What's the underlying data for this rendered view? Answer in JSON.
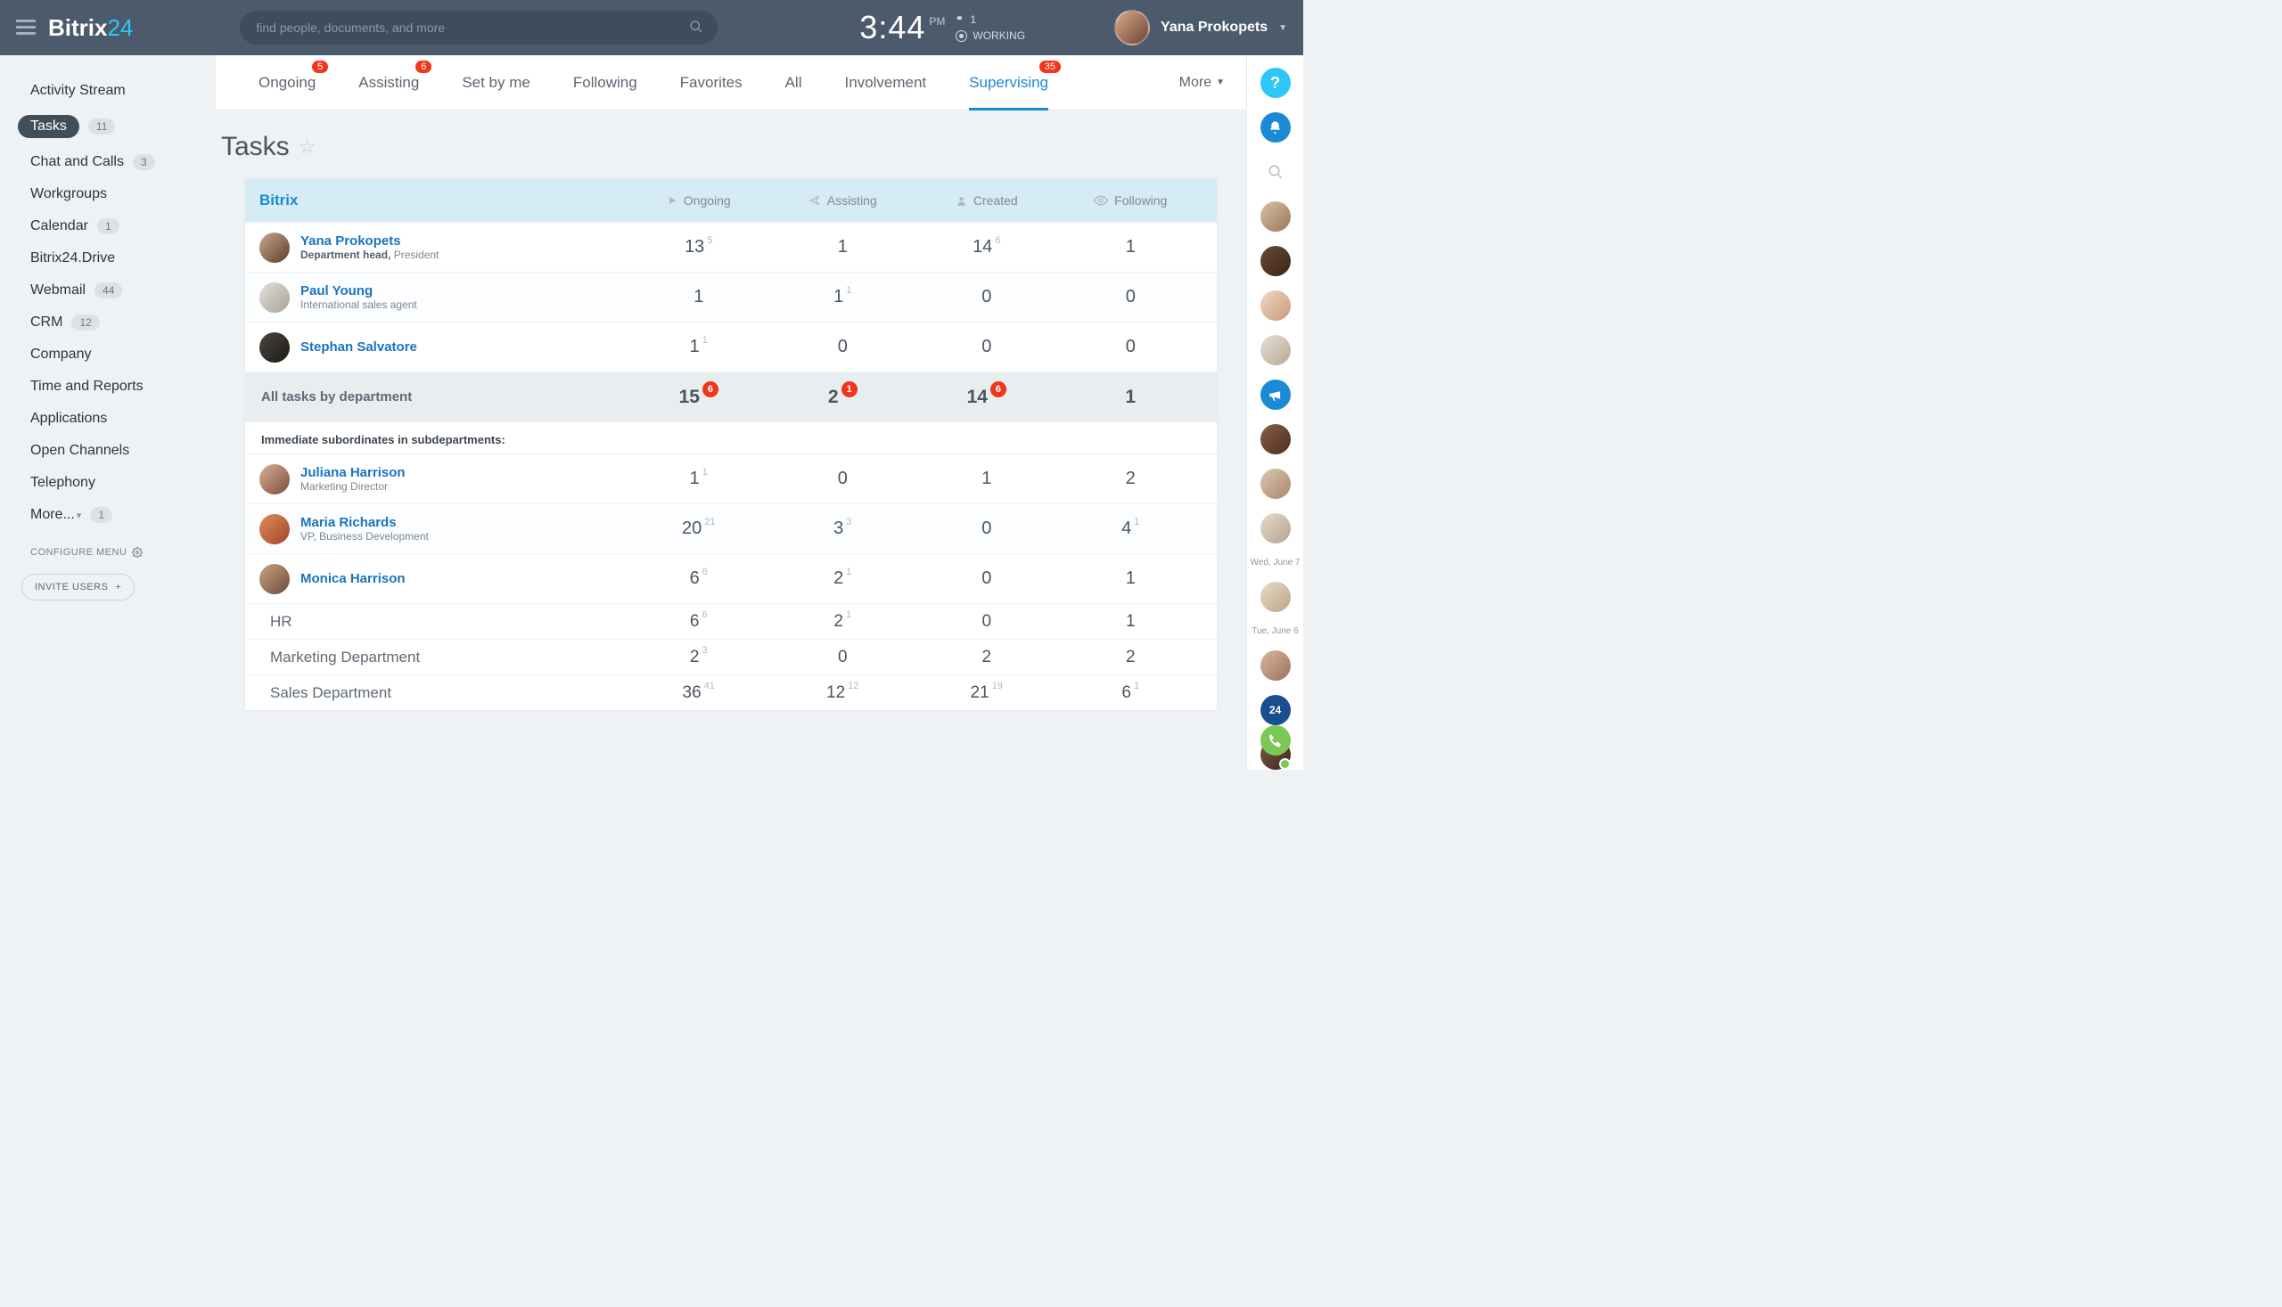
{
  "brand": {
    "a": "Bitrix",
    "b": "24"
  },
  "search": {
    "placeholder": "find people, documents, and more"
  },
  "clock": {
    "time": "3:44",
    "ampm": "PM",
    "flag": "1",
    "working": "WORKING"
  },
  "user": {
    "name": "Yana Prokopets"
  },
  "sidebar": {
    "items": [
      {
        "label": "Activity Stream"
      },
      {
        "label": "Tasks",
        "badge": "11",
        "active": true
      },
      {
        "label": "Chat and Calls",
        "badge": "3"
      },
      {
        "label": "Workgroups"
      },
      {
        "label": "Calendar",
        "badge": "1"
      },
      {
        "label": "Bitrix24.Drive"
      },
      {
        "label": "Webmail",
        "badge": "44"
      },
      {
        "label": "CRM",
        "badge": "12"
      },
      {
        "label": "Company"
      },
      {
        "label": "Time and Reports"
      },
      {
        "label": "Applications"
      },
      {
        "label": "Open Channels"
      },
      {
        "label": "Telephony"
      },
      {
        "label": "More... ",
        "badge": "1",
        "caret": true
      }
    ],
    "configure": "CONFIGURE MENU",
    "invite": "INVITE USERS"
  },
  "tabs": {
    "items": [
      {
        "label": "Ongoing",
        "badge": "5"
      },
      {
        "label": "Assisting",
        "badge": "6"
      },
      {
        "label": "Set by me"
      },
      {
        "label": "Following"
      },
      {
        "label": "Favorites"
      },
      {
        "label": "All"
      },
      {
        "label": "Involvement"
      },
      {
        "label": "Supervising",
        "badge": "35",
        "active": true
      }
    ],
    "more": "More"
  },
  "page": {
    "title": "Tasks"
  },
  "table": {
    "org": "Bitrix",
    "cols": [
      "Ongoing",
      "Assisting",
      "Created",
      "Following"
    ],
    "people": [
      {
        "name": "Yana Prokopets",
        "role_strong": "Department head,",
        "role": " President",
        "avbg": "linear-gradient(135deg,#caa78a,#5c3e2e)",
        "ongoing": "13",
        "ongoing_sup": "5",
        "assisting": "1",
        "created": "14",
        "created_sup": "6",
        "following": "1"
      },
      {
        "name": "Paul Young",
        "role": "International sales agent",
        "avbg": "linear-gradient(135deg,#e5e0d8,#a7a298)",
        "ongoing": "1",
        "assisting": "1",
        "assisting_sup": "1",
        "created": "0",
        "following": "0"
      },
      {
        "name": "Stephan Salvatore",
        "role": "",
        "avbg": "linear-gradient(135deg,#4a4540,#1e1a17)",
        "ongoing": "1",
        "ongoing_sup": "1",
        "assisting": "0",
        "created": "0",
        "following": "0"
      }
    ],
    "summary": {
      "label": "All tasks by department",
      "ongoing": "15",
      "ongoing_b": "6",
      "assisting": "2",
      "assisting_b": "1",
      "created": "14",
      "created_b": "6",
      "following": "1"
    },
    "subhead": "Immediate subordinates in subdepartments:",
    "subs": [
      {
        "name": "Juliana Harrison",
        "role": "Marketing Director",
        "avbg": "linear-gradient(135deg,#d9b098,#7a4e3a)",
        "ongoing": "1",
        "ongoing_sup": "1",
        "assisting": "0",
        "created": "1",
        "following": "2"
      },
      {
        "name": "Maria Richards",
        "role": "VP, Business Development",
        "avbg": "linear-gradient(135deg,#e08a5a,#a3452a)",
        "ongoing": "20",
        "ongoing_sup": "21",
        "assisting": "3",
        "assisting_sup": "3",
        "created": "0",
        "following": "4",
        "following_sup": "1"
      },
      {
        "name": "Monica Harrison",
        "role": "",
        "avbg": "linear-gradient(135deg,#c9a486,#6e4a36)",
        "ongoing": "6",
        "ongoing_sup": "6",
        "assisting": "2",
        "assisting_sup": "1",
        "created": "0",
        "following": "1"
      }
    ],
    "depts": [
      {
        "name": "HR",
        "ongoing": "6",
        "ongoing_sup": "6",
        "assisting": "2",
        "assisting_sup": "1",
        "created": "0",
        "following": "1"
      },
      {
        "name": "Marketing Department",
        "ongoing": "2",
        "ongoing_sup": "3",
        "assisting": "0",
        "created": "2",
        "following": "2"
      },
      {
        "name": "Sales Department",
        "ongoing": "36",
        "ongoing_sup": "41",
        "assisting": "12",
        "assisting_sup": "12",
        "created": "21",
        "created_sup": "19",
        "following": "6",
        "following_sup": "1"
      }
    ]
  },
  "rail": {
    "dates": [
      "Wed, June 7",
      "Tue, June 6"
    ]
  }
}
